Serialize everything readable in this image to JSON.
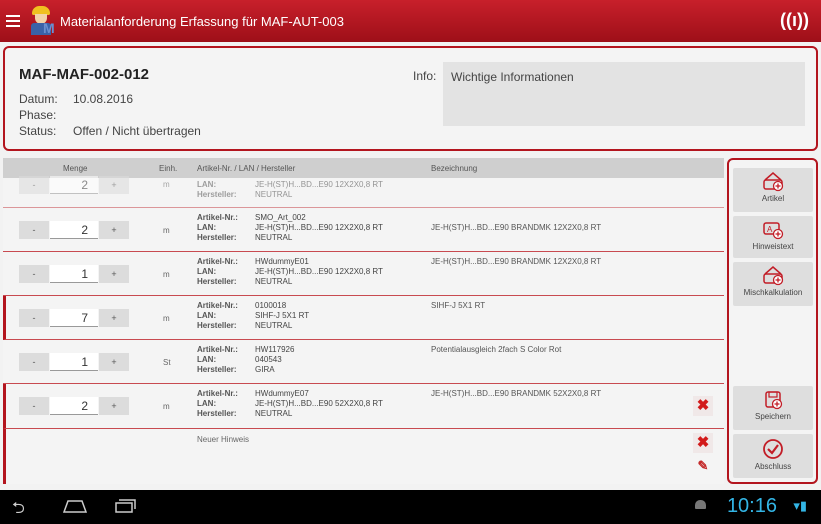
{
  "app": {
    "title": "Materialanforderung Erfassung für MAF-AUT-003"
  },
  "header": {
    "doc_id": "MAF-MAF-002-012",
    "datum_label": "Datum:",
    "datum_value": "10.08.2016",
    "phase_label": "Phase:",
    "phase_value": "",
    "status_label": "Status:",
    "status_value": "Offen / Nicht übertragen",
    "info_label": "Info:",
    "info_value": "Wichtige Informationen"
  },
  "table": {
    "columns": {
      "menge": "Menge",
      "einh": "Einh.",
      "artikel": "Artikel-Nr. / LAN / Hersteller",
      "bezeichnung": "Bezeichnung"
    },
    "field_labels": {
      "artikel": "Artikel-Nr.:",
      "lan": "LAN:",
      "hersteller": "Hersteller:"
    },
    "minus": "-",
    "plus": "+",
    "rows": [
      {
        "qty": "2",
        "unit": "m",
        "artikel": "",
        "lan": "JE-H(ST)H...BD...E90 12X2X0,8 RT",
        "hersteller": "NEUTRAL",
        "bezeichnung": ""
      },
      {
        "qty": "2",
        "unit": "m",
        "artikel": "SMO_Art_002",
        "lan": "JE-H(ST)H...BD...E90 12X2X0,8 RT",
        "hersteller": "NEUTRAL",
        "bezeichnung": "JE-H(ST)H...BD...E90 BRANDMK 12X2X0,8 RT"
      },
      {
        "qty": "1",
        "unit": "m",
        "artikel": "HWdummyE01",
        "lan": "JE-H(ST)H...BD...E90 12X2X0,8 RT",
        "hersteller": "NEUTRAL",
        "bezeichnung": "JE-H(ST)H...BD...E90 BRANDMK 12X2X0,8 RT"
      },
      {
        "qty": "7",
        "unit": "m",
        "artikel": "0100018",
        "lan": "SIHF-J 5X1 RT",
        "hersteller": "NEUTRAL",
        "bezeichnung": "SIHF-J 5X1 RT"
      },
      {
        "qty": "1",
        "unit": "St",
        "artikel": "HW117926",
        "lan": "040543",
        "hersteller": "GIRA",
        "bezeichnung": "Potentialausgleich 2fach S Color Rot"
      },
      {
        "qty": "2",
        "unit": "m",
        "artikel": "HWdummyE07",
        "lan": "JE-H(ST)H...BD...E90 52X2X0,8 RT",
        "hersteller": "NEUTRAL",
        "bezeichnung": "JE-H(ST)H...BD...E90 BRANDMK 52X2X0,8 RT"
      }
    ],
    "note_text": "Neuer Hinweis"
  },
  "actions": {
    "artikel": "Artikel",
    "hinweistext": "Hinweistext",
    "mischkalkulation": "Mischkalkulation",
    "speichern": "Speichern",
    "abschluss": "Abschluss"
  },
  "statusbar": {
    "time": "10:16"
  },
  "colors": {
    "brand_red": "#b3151e",
    "clock_blue": "#33b5e5"
  }
}
